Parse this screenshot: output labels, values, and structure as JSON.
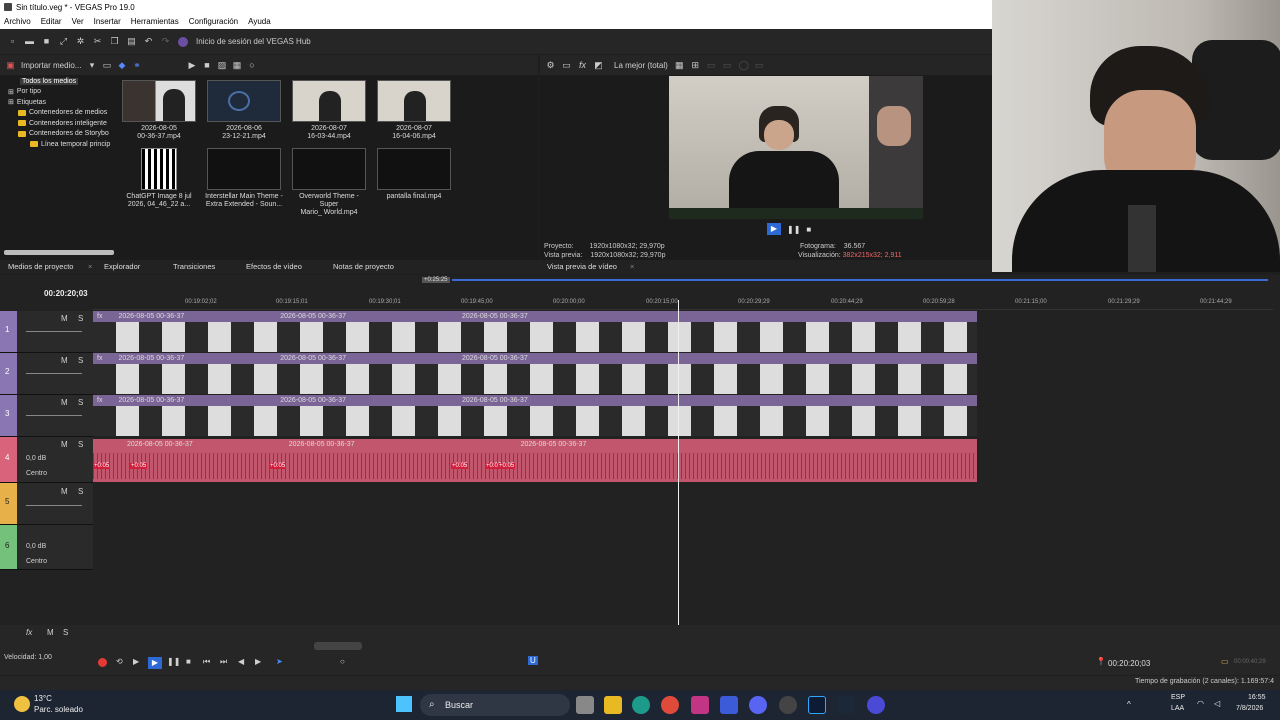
{
  "window": {
    "title": "Sin título.veg * - VEGAS Pro 19.0"
  },
  "menu": [
    "Archivo",
    "Editar",
    "Ver",
    "Insertar",
    "Herramientas",
    "Configuración",
    "Ayuda"
  ],
  "toolbar": {
    "hub_label": "Inicio de sesión del VEGAS Hub"
  },
  "media": {
    "import_label": "Importar medio...",
    "tree": [
      "Todos los medios",
      "Por tipo",
      "Etiquetas",
      "Contenedores de medios",
      "Contenedores inteligente",
      "Contenedores de Storybo",
      "Línea temporal princip"
    ],
    "items": [
      {
        "line1": "2026-08-05",
        "line2": "00-36-37.mp4"
      },
      {
        "line1": "2026-08-06",
        "line2": "23-12-21.mp4"
      },
      {
        "line1": "2026-08-07",
        "line2": "16-03-44.mp4"
      },
      {
        "line1": "2026-08-07",
        "line2": "16-04-06.mp4"
      },
      {
        "line1": "ChatGPT Image 8 jul",
        "line2": "2026, 04_46_22 a..."
      },
      {
        "line1": "Interstellar Main Theme -",
        "line2": "Extra Extended - Soun..."
      },
      {
        "line1": "Overworld Theme - Super",
        "line2": "Mario_ World.mp4"
      },
      {
        "line1": "pantalla final.mp4",
        "line2": ""
      }
    ]
  },
  "preview": {
    "quality": "La mejor (total)",
    "project_label": "Proyecto:",
    "project_value": "1920x1080x32; 29,970p",
    "preview_label": "Vista previa:",
    "preview_value": "1920x1080x32; 29,970p",
    "frame_label": "Fotograma:",
    "frame_value": "36.567",
    "display_label": "Visualización:",
    "display_value": "382x215x32; 2,911"
  },
  "tabs": [
    "Medios de proyecto",
    "Explorador",
    "Transiciones",
    "Efectos de vídeo",
    "Notas de proyecto",
    "Vista previa de vídeo"
  ],
  "timeline": {
    "timecode": "00:20:20;03",
    "ruler_ticks": [
      "00:19:02;02",
      "00:19:15;01",
      "00:19:30;01",
      "00:19:45;00",
      "00:20:00;00",
      "00:20:15;00",
      "00:20:29;29",
      "00:20:44;29",
      "00:20:59;28",
      "00:21:15;00",
      "00:21:29;29",
      "00:21:44;29"
    ],
    "region_marker": "+0:25:25",
    "tracks": [
      {
        "num": "1",
        "m": "M",
        "s": "S",
        "type": "video",
        "color": "#8a76b3"
      },
      {
        "num": "2",
        "m": "M",
        "s": "S",
        "type": "video",
        "color": "#8a76b3"
      },
      {
        "num": "3",
        "m": "M",
        "s": "S",
        "type": "video",
        "color": "#8a76b3"
      },
      {
        "num": "4",
        "m": "M",
        "s": "S",
        "type": "audio",
        "color": "#d9637b",
        "db": "0,0 dB",
        "pan": "Centro"
      },
      {
        "num": "5",
        "m": "M",
        "s": "S",
        "type": "audio",
        "color": "#e8b048"
      },
      {
        "num": "6",
        "m": "M",
        "s": "S",
        "type": "audio",
        "color": "#73c17a",
        "db": "0,0 dB",
        "pan": "Centro"
      }
    ],
    "clip_name": "2026-08-05 00-36-37",
    "audio_fades": [
      "+0:05",
      "+0:05",
      "+0:05",
      "+0:05",
      "+0:05",
      "+0:05"
    ]
  },
  "transport": {
    "speed": "Velocidad: 1,00",
    "timecode": "00:20:20;03",
    "end_time": "00:00:40;29"
  },
  "status": {
    "recording": "Tiempo de grabación (2 canales): 1.169:57:4"
  },
  "taskbar": {
    "weather_temp": "13°C",
    "weather_desc": "Parc. soleado",
    "search": "Buscar",
    "lang1": "ESP",
    "lang2": "LAA",
    "time": "16:55",
    "date": "7/8/2026"
  }
}
